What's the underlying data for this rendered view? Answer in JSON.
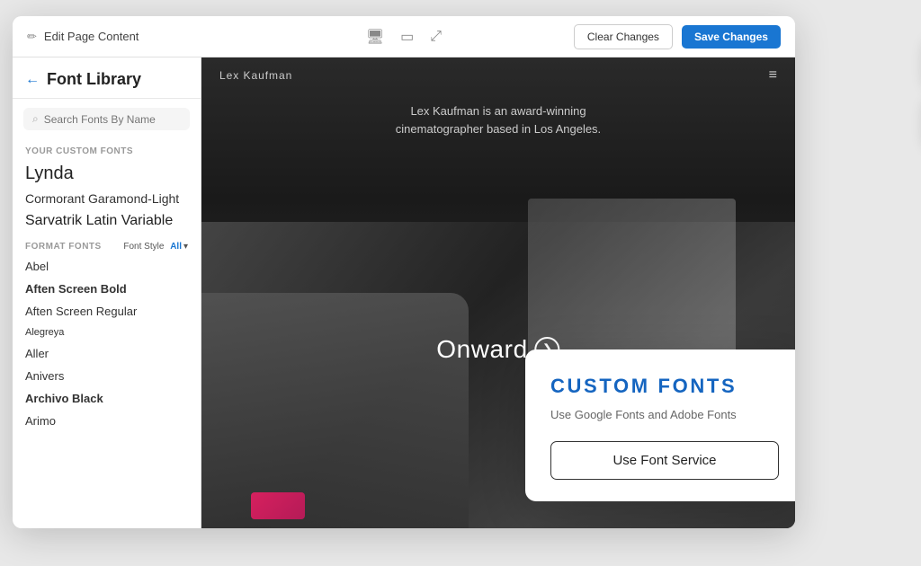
{
  "toolbar": {
    "edit_label": "Edit Page Content",
    "clear_label": "Clear Changes",
    "save_label": "Save Changes"
  },
  "sidebar": {
    "title": "Font Library",
    "search_placeholder": "Search Fonts By Name",
    "custom_fonts_label": "YOUR CUSTOM FONTS",
    "custom_fonts": [
      {
        "name": "Lynda",
        "style": "lynda"
      },
      {
        "name": "Cormorant Garamond-Light",
        "style": "cormorant"
      },
      {
        "name": "Sarvatrik Latin Variable",
        "style": "sarvatrik"
      }
    ],
    "format_fonts_label": "FORMAT FONTS",
    "font_style_label": "Font Style",
    "font_style_value": "All",
    "fonts": [
      {
        "name": "Abel",
        "bold": false,
        "small": false
      },
      {
        "name": "Aften Screen Bold",
        "bold": true,
        "small": false
      },
      {
        "name": "Aften Screen Regular",
        "bold": false,
        "small": false
      },
      {
        "name": "Alegreya",
        "bold": false,
        "small": true
      },
      {
        "name": "Aller",
        "bold": false,
        "small": false
      },
      {
        "name": "Anivers",
        "bold": false,
        "small": false
      },
      {
        "name": "Archivo Black",
        "bold": true,
        "small": false
      },
      {
        "name": "Arimo",
        "bold": false,
        "small": false
      }
    ]
  },
  "preview": {
    "logo": "Lex Kaufman",
    "subtitle_line1": "Lex Kaufman is an award-winning",
    "subtitle_line2": "cinematographer based in Los Angeles.",
    "cta_text": "Onward"
  },
  "popup": {
    "title": "CUSTOM  FONTS",
    "subtitle": "Use Google Fonts and Adobe Fonts",
    "button_label": "Use Font Service"
  },
  "icons": {
    "back_arrow": "←",
    "search": "🔍",
    "desktop": "🖥",
    "tablet": "⬜",
    "expand": "⤢",
    "menu": "≡",
    "caret": "›",
    "chevron_right": "❯",
    "pencil": "✏"
  }
}
